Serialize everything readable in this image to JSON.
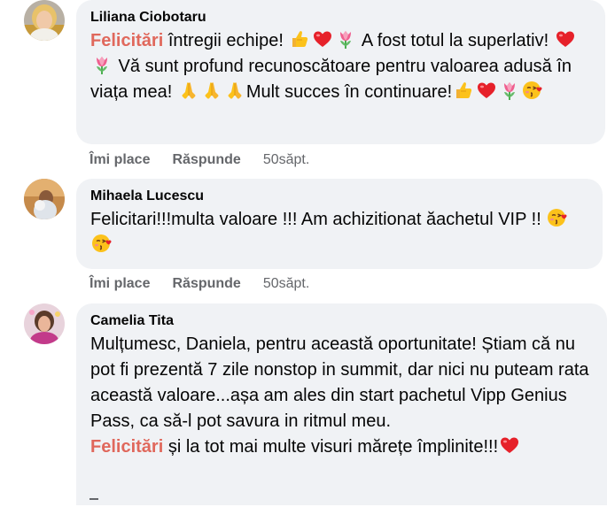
{
  "comments": [
    {
      "author": "Liliana Ciobotaru",
      "segments": [
        {
          "type": "hl",
          "text": "Felicitări"
        },
        {
          "type": "text",
          "text": " întregii echipe! "
        },
        {
          "type": "emoji",
          "name": "thumbs-up-icon"
        },
        {
          "type": "emoji",
          "name": "red-heart-icon"
        },
        {
          "type": "emoji",
          "name": "tulip-icon"
        },
        {
          "type": "text",
          "text": " A fost totul la superlativ! "
        },
        {
          "type": "emoji",
          "name": "red-heart-icon"
        },
        {
          "type": "emoji",
          "name": "tulip-icon"
        },
        {
          "type": "text",
          "text": " Vă sunt profund recunoscătoare pentru valoarea adusă în viața mea! "
        },
        {
          "type": "emoji",
          "name": "folded-hands-icon"
        },
        {
          "type": "emoji",
          "name": "folded-hands-icon"
        },
        {
          "type": "emoji",
          "name": "folded-hands-icon"
        },
        {
          "type": "text",
          "text": "Mult succes în continuare!"
        },
        {
          "type": "emoji",
          "name": "thumbs-up-icon"
        },
        {
          "type": "emoji",
          "name": "red-heart-icon"
        },
        {
          "type": "emoji",
          "name": "tulip-icon"
        },
        {
          "type": "emoji",
          "name": "face-blowing-kiss-icon"
        }
      ],
      "actions": {
        "like": "Îmi place",
        "reply": "Răspunde",
        "time": "50săpt."
      }
    },
    {
      "author": "Mihaela Lucescu",
      "segments": [
        {
          "type": "text",
          "text": "Felicitari!!!multa valoare !!! Am achizitionat ăachetul VIP !! "
        },
        {
          "type": "emoji",
          "name": "face-blowing-kiss-icon"
        },
        {
          "type": "emoji",
          "name": "face-blowing-kiss-icon"
        }
      ],
      "actions": {
        "like": "Îmi place",
        "reply": "Răspunde",
        "time": "50săpt."
      }
    },
    {
      "author": "Camelia Tita",
      "segments": [
        {
          "type": "text",
          "text": "Mulțumesc, Daniela, pentru această oportunitate! Știam că nu pot fi prezentă 7 zile nonstop in summit, dar nici nu puteam rata această valoare...așa am ales din start pachetul Vipp Genius Pass, ca să-l pot savura in ritmul meu."
        },
        {
          "type": "br"
        },
        {
          "type": "hl",
          "text": "Felicitări"
        },
        {
          "type": "text",
          "text": " și la tot mai multe visuri mărețe împlinite!!!"
        },
        {
          "type": "emoji",
          "name": "red-heart-icon"
        }
      ]
    }
  ],
  "colors": {
    "highlight": "#e0685c",
    "bubble": "#f0f2f5",
    "secondary_text": "#65676b"
  }
}
